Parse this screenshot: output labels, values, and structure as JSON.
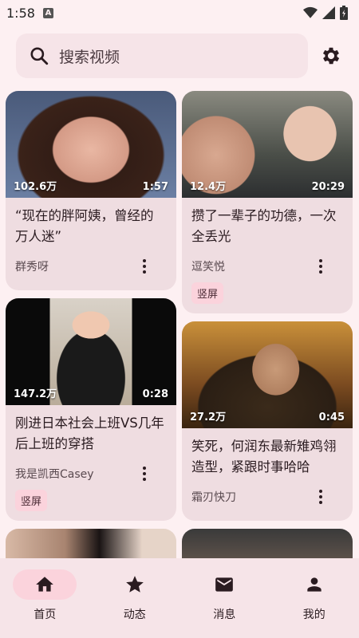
{
  "status": {
    "time": "1:58",
    "badge": "A"
  },
  "search": {
    "placeholder": "搜索视频"
  },
  "videos": [
    {
      "views": "102.6万",
      "duration": "1:57",
      "title": "“现在的胖阿姨，曾经的万人迷”",
      "author": "群秀呀",
      "tag": ""
    },
    {
      "views": "12.4万",
      "duration": "20:29",
      "title": "攒了一辈子的功德，一次全丢光",
      "author": "逗笑悦",
      "tag": "竖屏"
    },
    {
      "views": "147.2万",
      "duration": "0:28",
      "title": "刚进日本社会上班VS几年后上班的穿搭",
      "author": "我是凯西Casey",
      "tag": "竖屏"
    },
    {
      "views": "27.2万",
      "duration": "0:45",
      "title": "笑死，何润东最新雉鸡翎造型，紧跟时事哈哈",
      "author": "霜刃快刀",
      "tag": ""
    }
  ],
  "nav": [
    {
      "label": "首页",
      "icon": "home-icon",
      "active": true
    },
    {
      "label": "动态",
      "icon": "star-icon",
      "active": false
    },
    {
      "label": "消息",
      "icon": "mail-icon",
      "active": false
    },
    {
      "label": "我的",
      "icon": "person-icon",
      "active": false
    }
  ]
}
